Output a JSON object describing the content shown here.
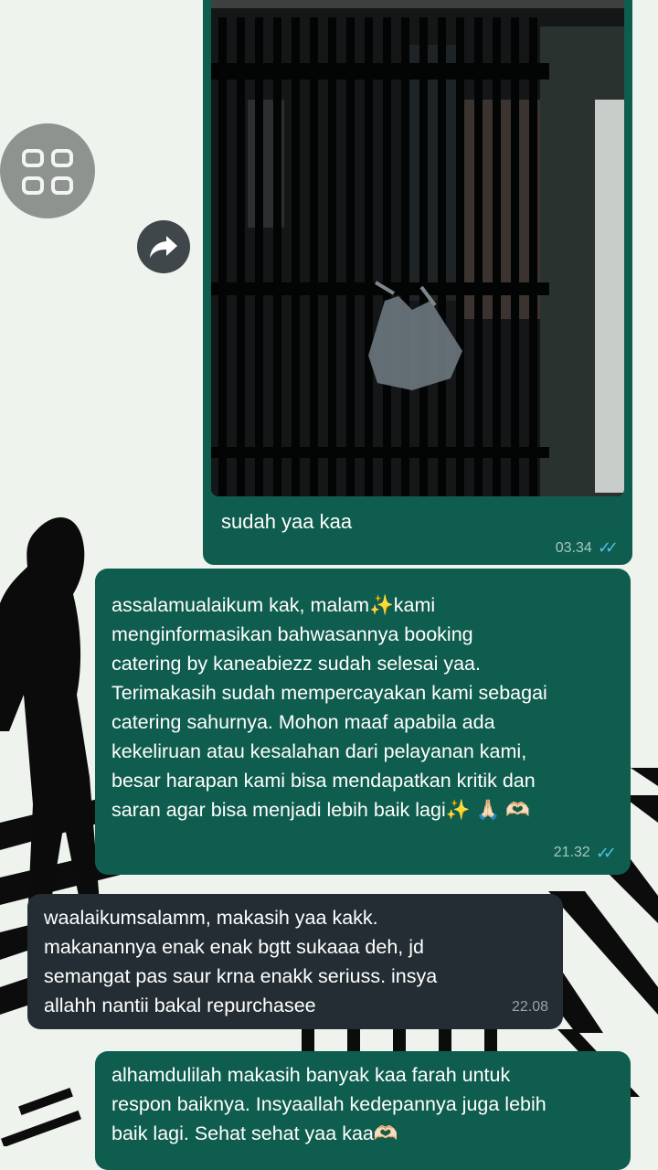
{
  "colors": {
    "outgoing_bubble": "#0f5d4e",
    "incoming_bubble": "#232d33",
    "read_ticks": "#53bdeb",
    "wallpaper": "#eef3ee"
  },
  "icons": {
    "gallery": "grid-icon",
    "forward": "forward-arrow-icon",
    "read_status": "double-check-icon"
  },
  "messages": [
    {
      "type": "image",
      "direction": "outgoing",
      "caption": "sudah yaa kaa",
      "time": "03.34",
      "read": true
    },
    {
      "type": "text",
      "direction": "outgoing",
      "lines": [
        "assalamualaikum kak, malam✨kami",
        "menginformasikan bahwasannya booking",
        "catering by kaneabiezz sudah selesai yaa.",
        "Terimakasih sudah mempercayakan kami sebagai",
        "catering sahurnya. Mohon maaf apabila ada",
        "kekeliruan atau kesalahan dari pelayanan kami,",
        "besar harapan kami bisa mendapatkan kritik dan",
        "saran agar bisa menjadi lebih baik lagi✨ 🙏🏻 🫶🏻"
      ],
      "time": "21.32",
      "read": true
    },
    {
      "type": "text",
      "direction": "incoming",
      "lines": [
        "waalaikumsalamm, makasih yaa kakk.",
        "makanannya enak enak bgtt sukaaa deh, jd",
        "semangat pas saur krna enakk seriuss. insya",
        "allahh nantii bakal repurchasee"
      ],
      "time": "22.08"
    },
    {
      "type": "text",
      "direction": "outgoing",
      "lines": [
        "alhamdulilah makasih banyak kaa farah untuk",
        "respon baiknya. Insyaallah kedepannya juga lebih",
        "baik lagi. Sehat sehat yaa kaa🫶🏻"
      ]
    }
  ]
}
